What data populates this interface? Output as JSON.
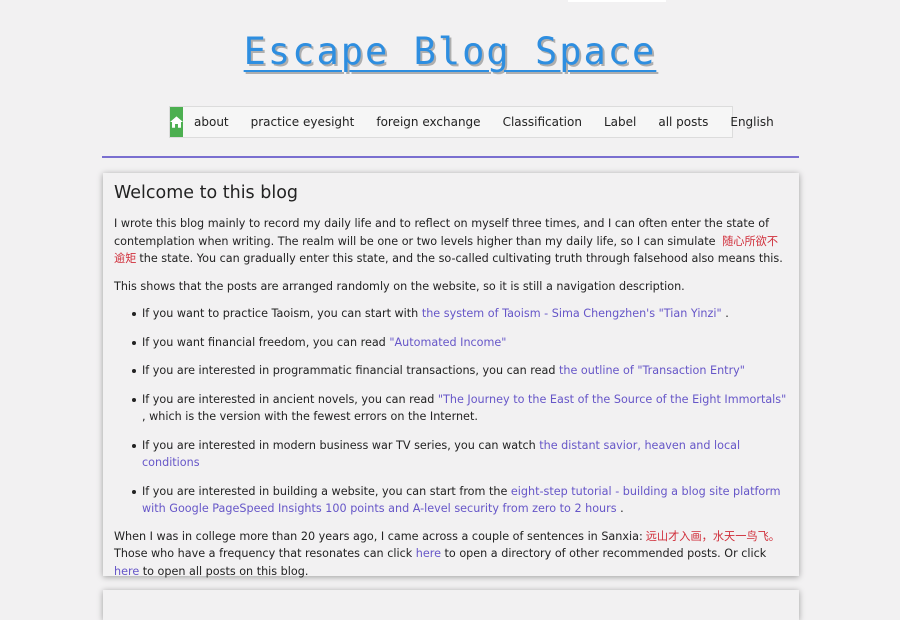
{
  "site": {
    "title": "Escape Blog Space"
  },
  "nav": {
    "home_icon": "home-icon",
    "items": [
      "about",
      "practice eyesight",
      "foreign exchange",
      "Classification",
      "Label",
      "all posts",
      "English"
    ]
  },
  "post": {
    "title": "Welcome to this blog",
    "p1_a": "I wrote this blog mainly to record my daily life and to reflect on myself three times, and I can often enter the state of contemplation when writing. The realm will be one or two levels higher than my daily life, so I can simulate",
    "p1_cn": "随心所欲不逾矩",
    "p1_b": "the state. You can gradually enter this state, and the so-called cultivating truth through falsehood also means this.",
    "p2": "This shows that the posts are arranged randomly on the website, so it is still a navigation description.",
    "bullets": [
      {
        "pre": "If you want to practice Taoism, you can start with ",
        "link": "the system of Taoism - Sima Chengzhen's \"Tian Yinzi\"",
        "post": " ."
      },
      {
        "pre": "If you want financial freedom, you can read ",
        "link": "\"Automated Income\"",
        "post": ""
      },
      {
        "pre": "If you are interested in programmatic financial transactions, you can read ",
        "link": "the outline of \"Transaction Entry\"",
        "post": ""
      },
      {
        "pre": "If you are interested in ancient novels, you can read ",
        "link": "\"The Journey to the East of the Source of the Eight Immortals\"",
        "post": " , which is the version with the fewest errors on the Internet."
      },
      {
        "pre": "If you are interested in modern business war TV series, you can watch ",
        "link": "the distant savior, heaven and local conditions",
        "post": ""
      },
      {
        "pre": "If you are interested in building a website, you can start from the ",
        "link": "eight-step tutorial - building a blog site platform with Google PageSpeed Insights 100 points and A-level security from zero to 2 hours",
        "post": " ."
      }
    ],
    "p3_a": "When I was in college more than 20 years ago, I came across a couple of sentences in Sanxia:",
    "p3_cn": "远山才入画，水天一鸟飞。",
    "p3_b": " Those who have a frequency that resonates can click ",
    "p3_link1": "here",
    "p3_c": " to open a directory of other recommended posts. Or click ",
    "p3_link2": "here",
    "p3_d": " to open all posts on this blog."
  },
  "colors": {
    "accent_title": "#2e8ee0",
    "home_green": "#4caf50",
    "link": "#6656c8",
    "chinese_red": "#d02e3a",
    "divider": "#7a6fd0"
  }
}
